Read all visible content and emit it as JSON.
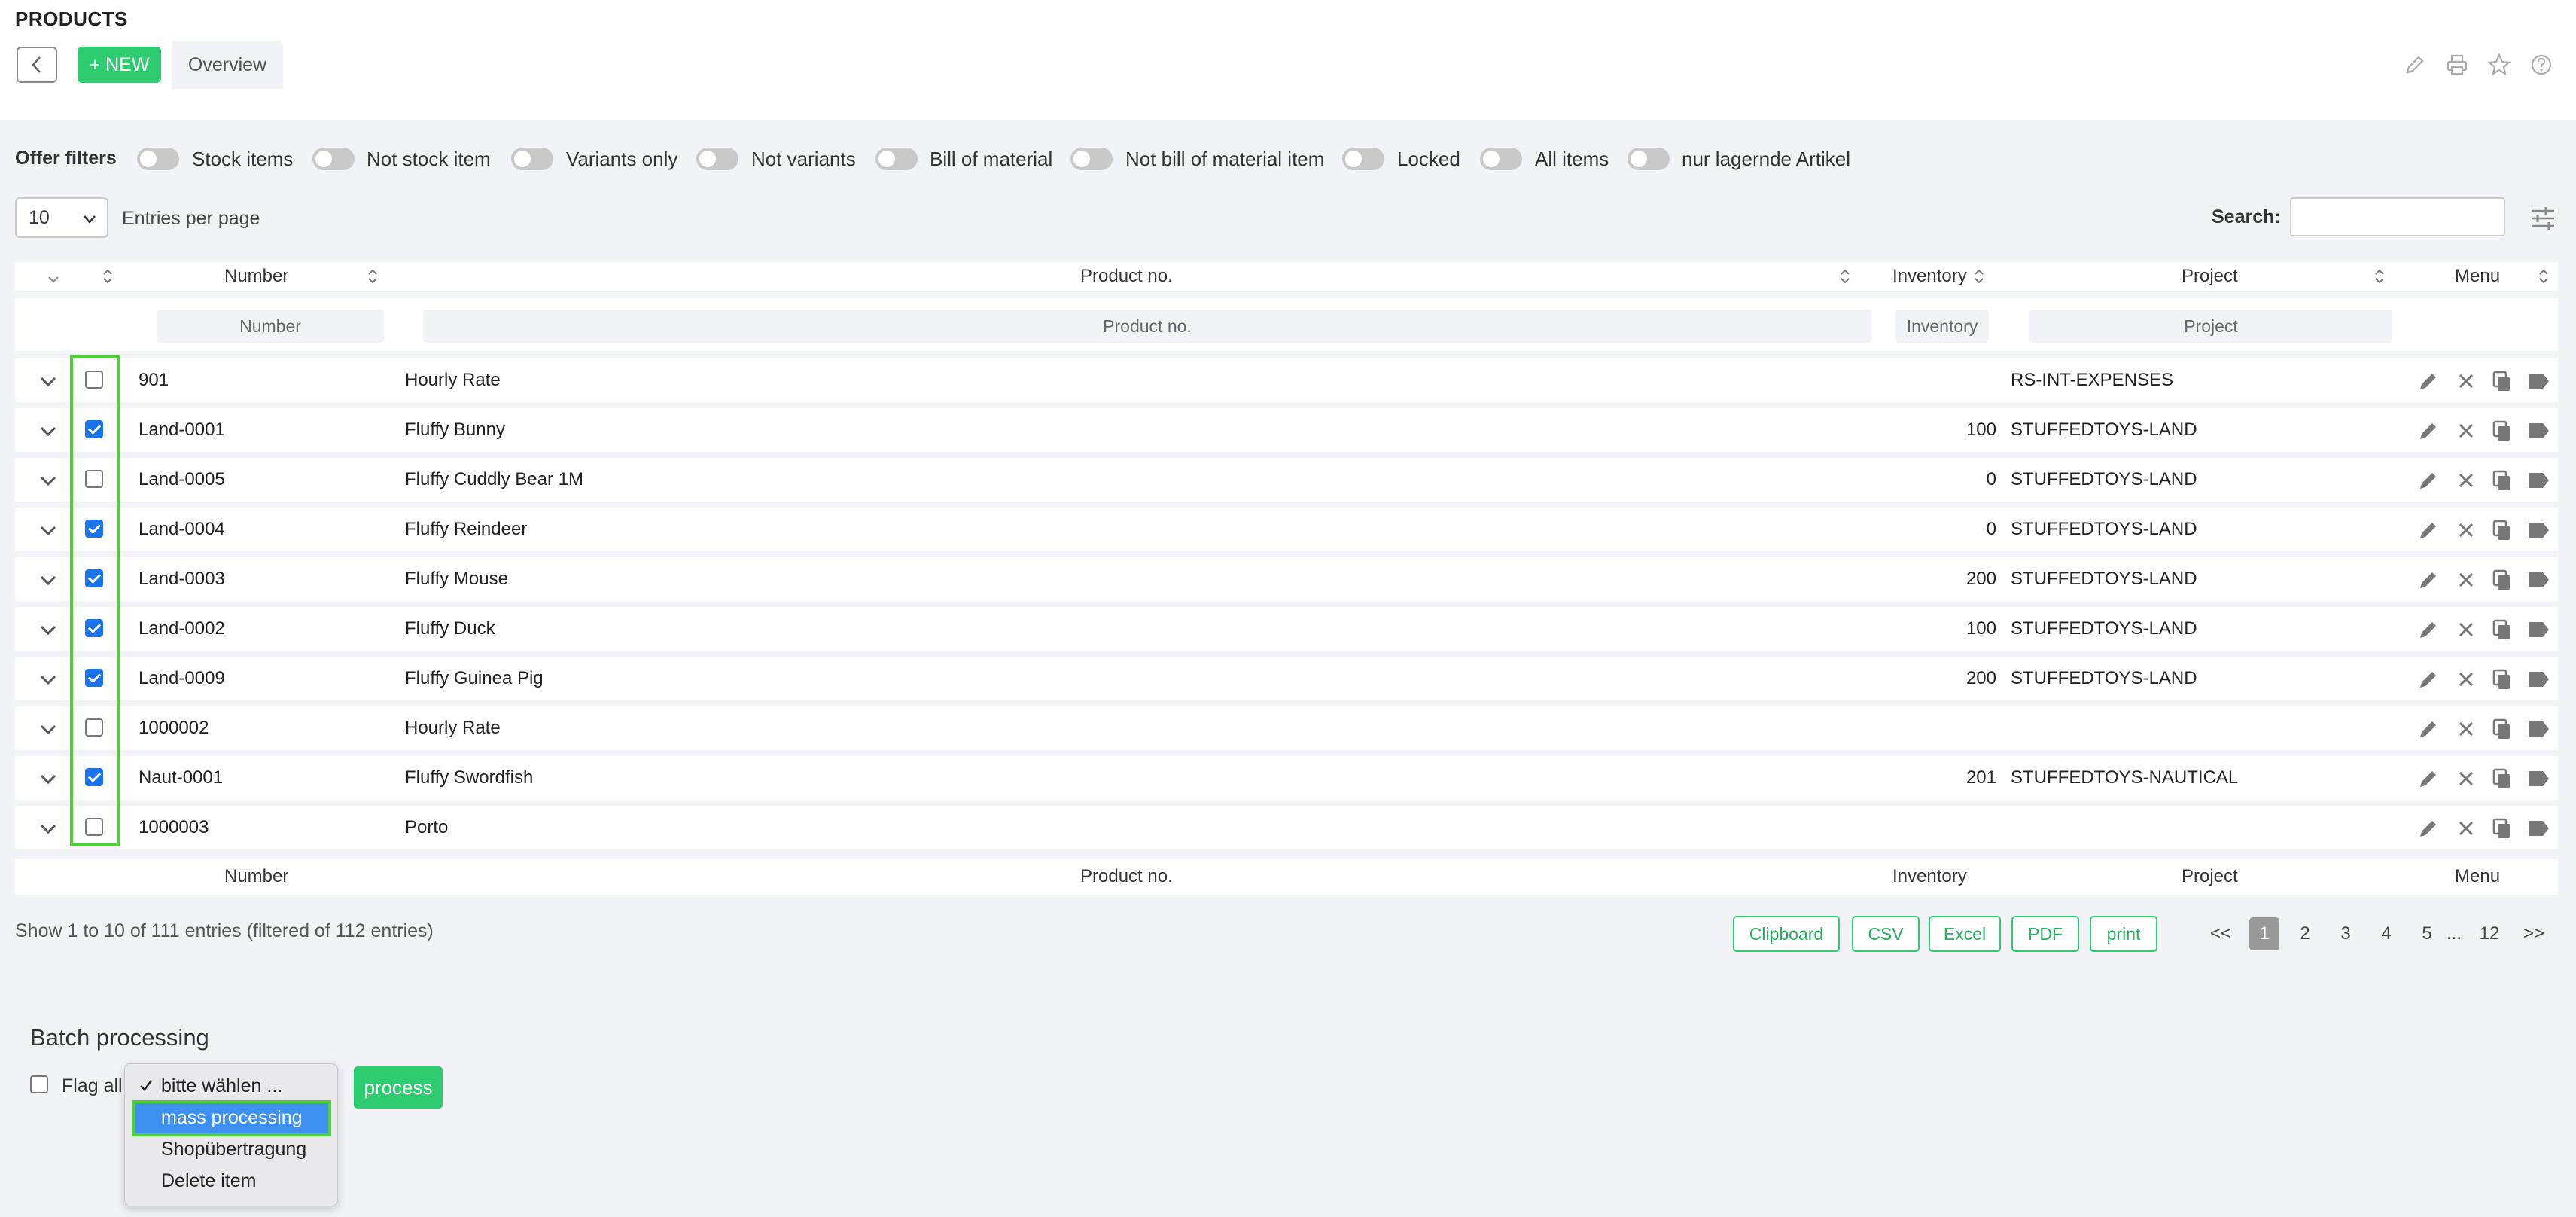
{
  "header": {
    "title": "PRODUCTS",
    "new_label": "+ NEW",
    "tab_label": "Overview"
  },
  "filters": {
    "label": "Offer filters",
    "items": [
      "Stock items",
      "Not stock item",
      "Variants only",
      "Not variants",
      "Bill of material",
      "Not bill of material item",
      "Locked",
      "All items",
      "nur lagernde Artikel"
    ]
  },
  "controls": {
    "entries_value": "10",
    "entries_label": "Entries per page",
    "search_label": "Search:"
  },
  "table": {
    "headers": {
      "number": "Number",
      "product": "Product no.",
      "inventory": "Inventory",
      "project": "Project",
      "menu": "Menu"
    },
    "filter_placeholders": {
      "number": "Number",
      "product": "Product no.",
      "inventory": "Inventory",
      "project": "Project"
    },
    "rows": [
      {
        "number": "901",
        "product": "Hourly Rate",
        "inventory": "",
        "project": "RS-INT-EXPENSES",
        "checked": false
      },
      {
        "number": "Land-0001",
        "product": "Fluffy Bunny",
        "inventory": "100",
        "project": "STUFFEDTOYS-LAND",
        "checked": true
      },
      {
        "number": "Land-0005",
        "product": "Fluffy Cuddly Bear 1M",
        "inventory": "0",
        "project": "STUFFEDTOYS-LAND",
        "checked": false
      },
      {
        "number": "Land-0004",
        "product": "Fluffy Reindeer",
        "inventory": "0",
        "project": "STUFFEDTOYS-LAND",
        "checked": true
      },
      {
        "number": "Land-0003",
        "product": "Fluffy Mouse",
        "inventory": "200",
        "project": "STUFFEDTOYS-LAND",
        "checked": true
      },
      {
        "number": "Land-0002",
        "product": "Fluffy Duck",
        "inventory": "100",
        "project": "STUFFEDTOYS-LAND",
        "checked": true
      },
      {
        "number": "Land-0009",
        "product": "Fluffy Guinea Pig",
        "inventory": "200",
        "project": "STUFFEDTOYS-LAND",
        "checked": true
      },
      {
        "number": "1000002",
        "product": "Hourly Rate",
        "inventory": "",
        "project": "",
        "checked": false
      },
      {
        "number": "Naut-0001",
        "product": "Fluffy Swordfish",
        "inventory": "201",
        "project": "STUFFEDTOYS-NAUTICAL",
        "checked": true
      },
      {
        "number": "1000003",
        "product": "Porto",
        "inventory": "",
        "project": "",
        "checked": false
      }
    ]
  },
  "footer": {
    "info": "Show 1 to 10 of 111 entries (filtered of 112 entries)",
    "export_buttons": [
      "Clipboard",
      "CSV",
      "Excel",
      "PDF",
      "print"
    ],
    "pagination": {
      "prev": "<<",
      "pages": [
        "1",
        "2",
        "3",
        "4",
        "5"
      ],
      "ellipsis": "...",
      "last": "12",
      "next": ">>",
      "current": "1"
    }
  },
  "batch": {
    "title": "Batch processing",
    "flag_all": "Flag all",
    "options": [
      "bitte wählen ...",
      "mass processing",
      "Shopübertragung",
      "Delete item"
    ],
    "selected_option": "mass processing",
    "checked_option": "bitte wählen ...",
    "process_label": "process"
  },
  "colors": {
    "accent": "#2ecc71",
    "highlight": "#4cd137",
    "select_blue": "#3d8ff0",
    "checkbox_blue": "#1a73e8"
  }
}
